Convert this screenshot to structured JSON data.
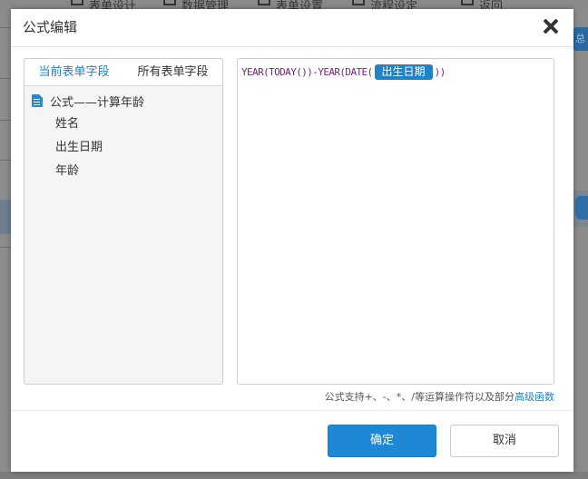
{
  "background": {
    "tabs": [
      "表单设计",
      "数据管理",
      "表单设置",
      "流程设定",
      "返回"
    ],
    "right_button": "总"
  },
  "dialog": {
    "title": "公式编辑",
    "field_tabs": [
      {
        "label": "当前表单字段",
        "active": true
      },
      {
        "label": "所有表单字段",
        "active": false
      }
    ],
    "tree_root": "公式——计算年龄",
    "fields": [
      "姓名",
      "出生日期",
      "年龄"
    ],
    "formula": {
      "prefix": "YEAR(TODAY())-YEAR(DATE(",
      "field_token": "出生日期",
      "suffix": "))"
    },
    "hint_text": "公式支持+、-、*、/等运算操作符以及部分",
    "hint_link": "高级函数",
    "ok_label": "确定",
    "cancel_label": "取消"
  },
  "colors": {
    "accent": "#1e82c8",
    "primary_button": "#1e88d6",
    "formula_text": "#7a1f86"
  }
}
